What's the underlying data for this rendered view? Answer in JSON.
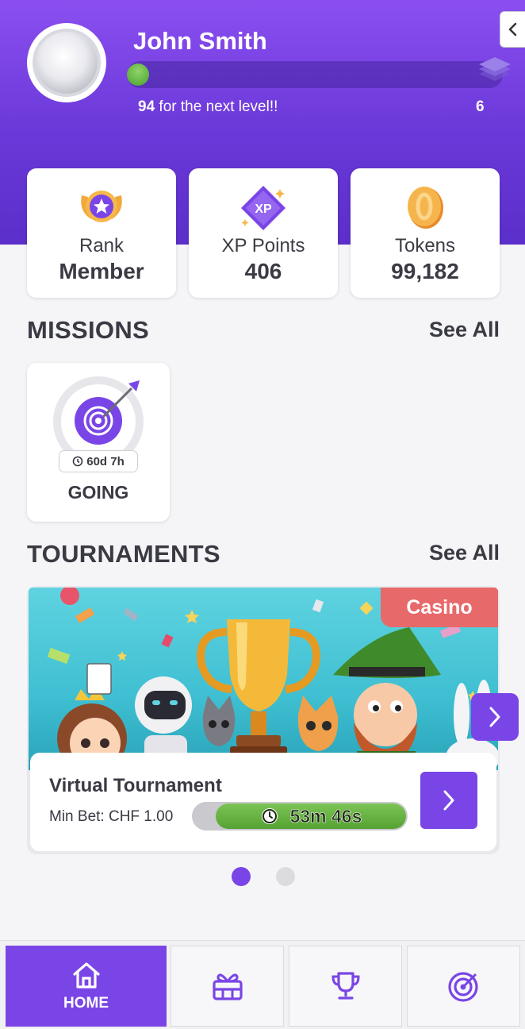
{
  "user": {
    "name": "John Smith",
    "points_to_next_level": "94",
    "next_level_suffix": " for the next level!!",
    "level": "6",
    "level_progress": 0.03
  },
  "stats": [
    {
      "label": "Rank",
      "value": "Member",
      "icon": "rank-badge-icon"
    },
    {
      "label": "XP Points",
      "value": "406",
      "icon": "xp-diamond-icon"
    },
    {
      "label": "Tokens",
      "value": "99,182",
      "icon": "token-coin-icon"
    }
  ],
  "missions": {
    "title": "MISSIONS",
    "see_all": "See All",
    "items": [
      {
        "timer": "60d 7h",
        "status": "GOING",
        "icon": "target-arrow-icon"
      }
    ]
  },
  "tournaments": {
    "title": "TOURNAMENTS",
    "see_all": "See All",
    "items": [
      {
        "category": "Casino",
        "name": "Virtual Tournament",
        "min_bet": "Min Bet: CHF 1.00",
        "time_left": "53m 46s"
      }
    ],
    "pagination": {
      "current": 1,
      "total": 2
    }
  },
  "nav": [
    {
      "label": "HOME",
      "icon": "home-icon",
      "active": true
    },
    {
      "label": "",
      "icon": "gift-icon",
      "active": false
    },
    {
      "label": "",
      "icon": "trophy-icon",
      "active": false
    },
    {
      "label": "",
      "icon": "target-icon",
      "active": false
    }
  ],
  "colors": {
    "accent": "#7a45e6",
    "header_top": "#8b4ff0",
    "casino_tag": "#e8696a",
    "timer_green": "#54a233"
  }
}
